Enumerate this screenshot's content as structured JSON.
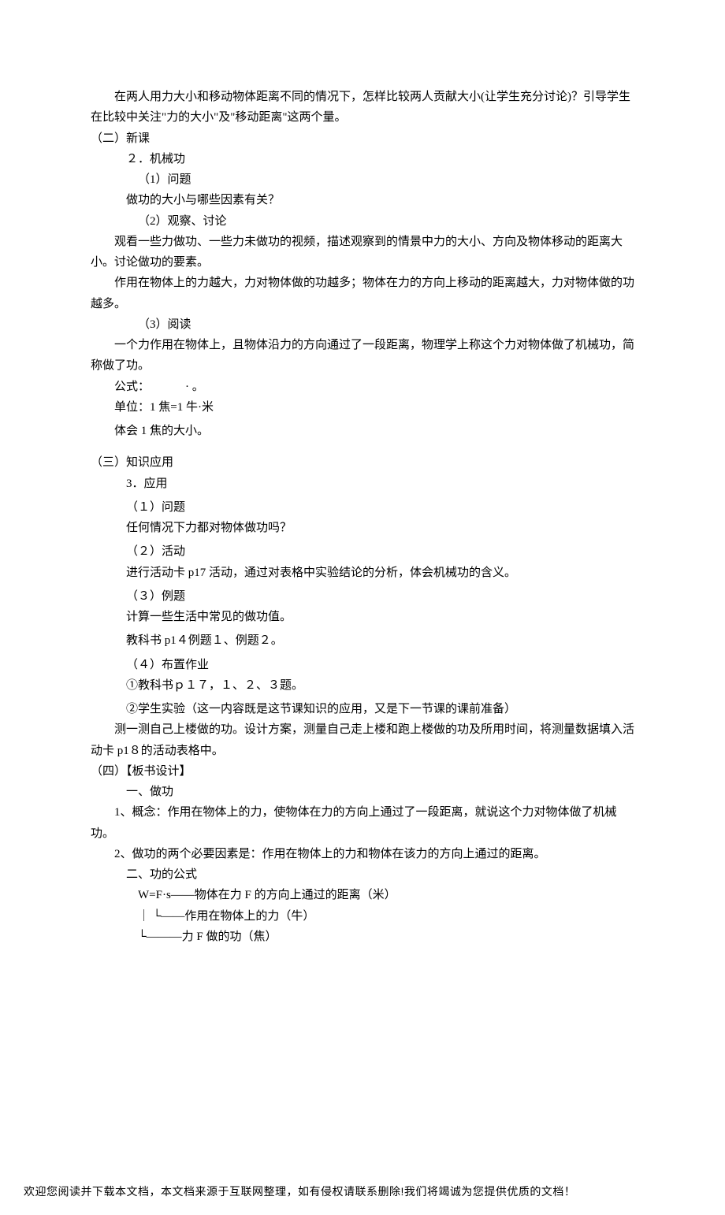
{
  "intro": "在两人用力大小和移动物体距离不同的情况下，怎样比较两人贡献大小(让学生充分讨论)？引导学生在比较中关注\"力的大小\"及\"移动距离\"这两个量。",
  "sec2": {
    "head": "（二）新课",
    "item2": "２．机械功",
    "q1_h": "（1）问题",
    "q1": "做功的大小与哪些因素有关？",
    "q2_h": "（2）观察、讨论",
    "q2a": "观看一些力做功、一些力未做功的视频，描述观察到的情景中力的大小、方向及物体移动的距离大小。讨论做功的要素。",
    "q2b": "作用在物体上的力越大，力对物体做的功越多；物体在力的方向上移动的距离越大，力对物体做的功越多。",
    "q3_h": "（3）阅读",
    "q3a": "一个力作用在物体上，且物体沿力的方向通过了一段距离，物理学上称这个力对物体做了机械功，简称做了功。",
    "formula_label": "公式：",
    "formula_dot": "·  。",
    "unit": "单位：1 焦=1 牛·米",
    "feel": "体会 1 焦的大小。"
  },
  "sec3": {
    "head": "（三）知识应用",
    "item3": "3．应用",
    "p1_h": "（１）问题",
    "p1": "任何情况下力都对物体做功吗？",
    "p2_h": "（２）活动",
    "p2": "进行活动卡 p17 活动，通过对表格中实验结论的分析，体会机械功的含义。",
    "p3_h": "（３）例题",
    "p3a": "计算一些生活中常见的做功值。",
    "p3b": "教科书 p1４例题１、例题２。",
    "p4_h": "（４）布置作业",
    "p4a": "①教科书ｐ１７，１、２、３题。",
    "p4b": "②学生实验（这一内容既是这节课知识的应用，又是下一节课的课前准备）",
    "p4c": "测一测自己上楼做的功。设计方案，测量自己走上楼和跑上楼做的功及所用时间，将测量数据填入活动卡 p1８的活动表格中。"
  },
  "sec4": {
    "head": "（四）【板书设计】",
    "h1": "一、做功",
    "b1": "1、概念：作用在物体上的力，使物体在力的方向上通过了一段距离，就说这个力对物体做了机械功。",
    "b2": "2、做功的两个必要因素是：作用在物体上的力和物体在该力的方向上通过的距离。",
    "h2": "二、功的公式",
    "f1": "W=F·s——物体在力 F 的方向上通过的距离（米）",
    "f2": "｜ └——作用在物体上的力（牛）",
    "f3": "└———力 F 做的功（焦）"
  },
  "footer": "欢迎您阅读并下载本文档，本文档来源于互联网整理，如有侵权请联系删除!我们将竭诚为您提供优质的文档！"
}
